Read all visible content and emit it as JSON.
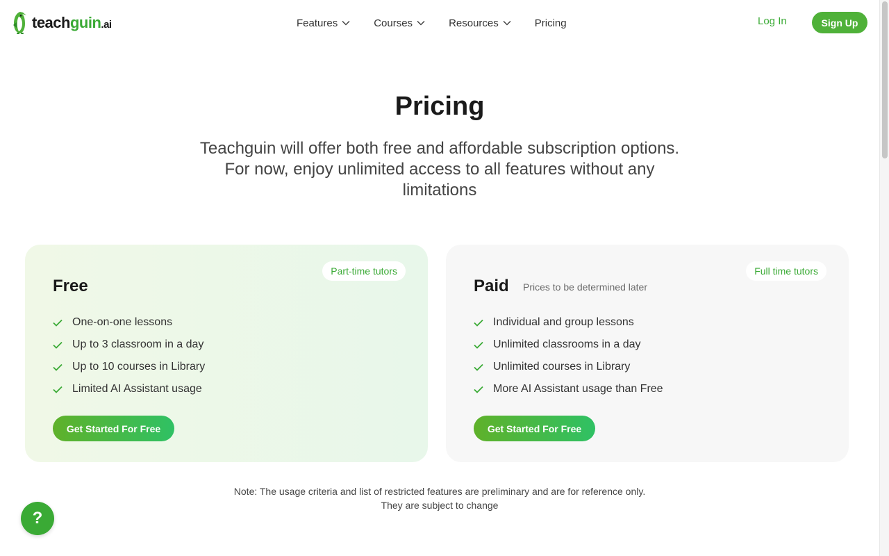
{
  "header": {
    "logo": {
      "part1": "teach",
      "part2": "guin",
      "suffix": ".ai"
    },
    "nav": [
      {
        "label": "Features",
        "has_dropdown": true
      },
      {
        "label": "Courses",
        "has_dropdown": true
      },
      {
        "label": "Resources",
        "has_dropdown": true
      },
      {
        "label": "Pricing",
        "has_dropdown": false
      }
    ],
    "login_label": "Log In",
    "signup_label": "Sign Up"
  },
  "hero": {
    "title": "Pricing",
    "subtitle": "Teachguin will offer both free and affordable subscription options. For now, enjoy unlimited access to all features without any limitations"
  },
  "plans": {
    "free": {
      "name": "Free",
      "badge": "Part-time tutors",
      "features": [
        "One-on-one lessons",
        "Up to 3 classroom in a day",
        "Up to 10 courses in Library",
        "Limited AI Assistant usage"
      ],
      "cta": "Get Started For Free"
    },
    "paid": {
      "name": "Paid",
      "note": "Prices to be determined later",
      "badge": "Full time tutors",
      "features": [
        "Individual and group lessons",
        "Unlimited classrooms in a day",
        "Unlimited courses in Library",
        "More AI Assistant usage than Free"
      ],
      "cta": "Get Started For Free"
    }
  },
  "footer_note": "Note: The usage criteria and list of restricted features are preliminary and are for reference only. They are subject to change",
  "help_button": {
    "label": "?",
    "icon": "question-icon"
  },
  "colors": {
    "brand_green": "#3aaa35",
    "button_gradient_start": "#5fb12a",
    "button_gradient_end": "#2fc164",
    "free_card_bg": "#f0f8e7",
    "paid_card_bg": "#f7f7f7"
  }
}
